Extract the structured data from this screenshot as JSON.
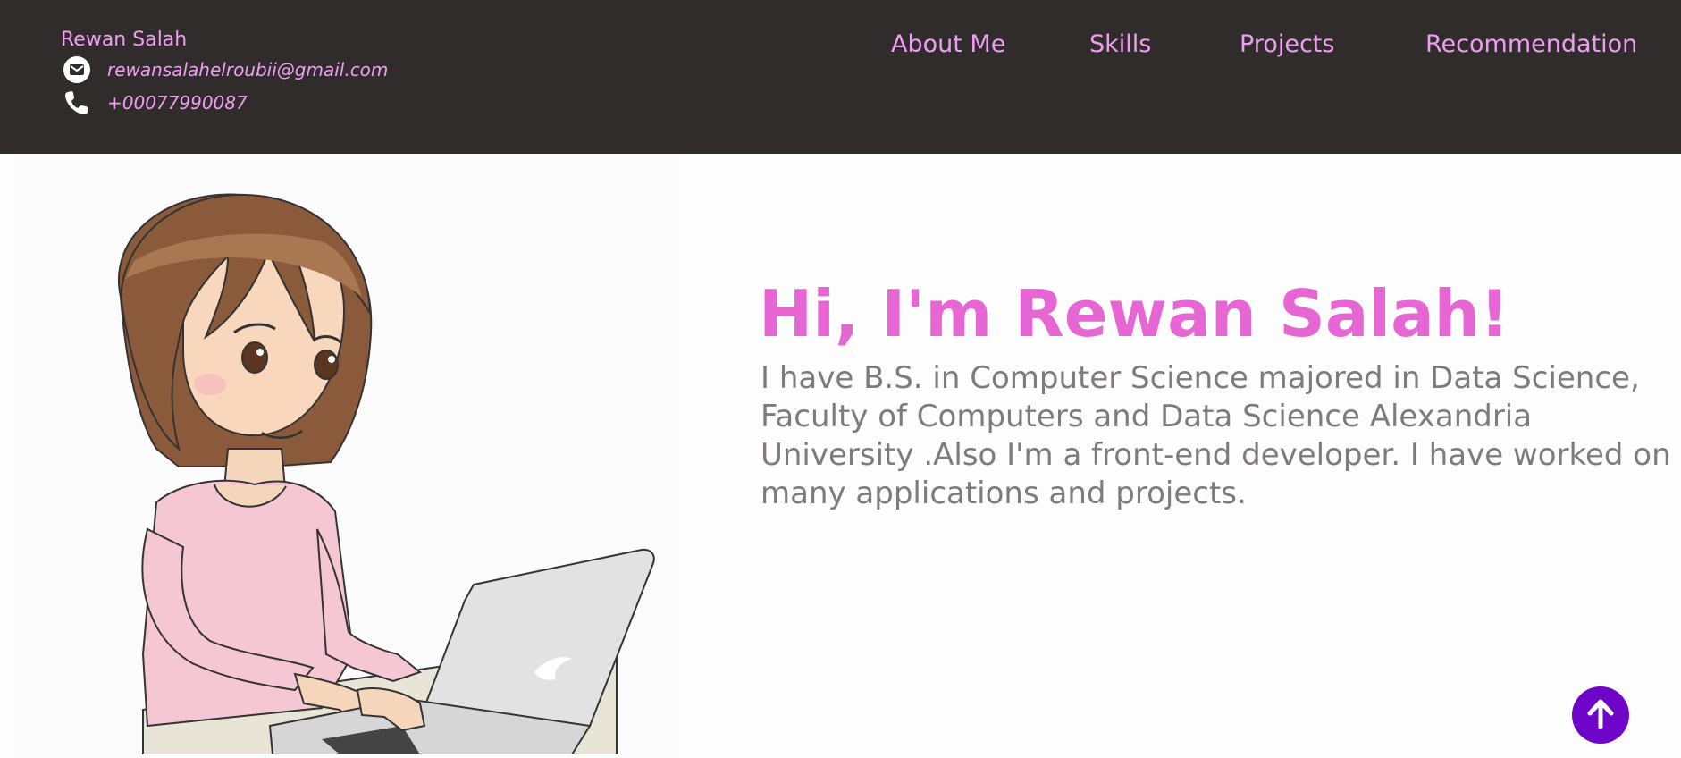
{
  "header": {
    "name": "Rewan Salah",
    "email": "rewansalahelroubii@gmail.com",
    "phone": "+00077990087"
  },
  "nav": {
    "items": [
      {
        "label": "About Me"
      },
      {
        "label": "Skills"
      },
      {
        "label": "Projects"
      },
      {
        "label": "Recommendation"
      }
    ]
  },
  "hero": {
    "title": "Hi, I'm Rewan Salah!",
    "description": "I have B.S. in Computer Science majored in Data Science, Faculty of Computers and Data Science Alexandria University .Also I'm a front-end developer. I have worked on many applications and projects."
  },
  "colors": {
    "header_bg": "#312c2c",
    "accent_pink": "#ee9ef0",
    "title_pink": "#e667d4",
    "text_gray": "#7f7b7b",
    "scroll_button": "#6e05c8"
  },
  "icons": {
    "email": "envelope-icon",
    "phone": "phone-icon",
    "scroll_top": "arrow-up-icon"
  }
}
